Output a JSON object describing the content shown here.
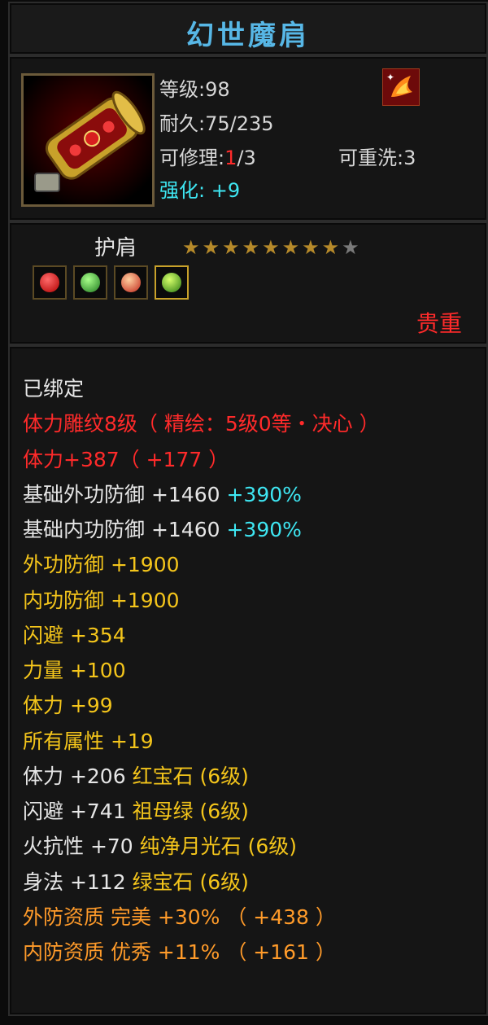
{
  "item": {
    "name": "幻世魔肩",
    "level_label": "等级:98",
    "durability_label": "耐久:75/235",
    "repair_prefix": "可修理:",
    "repair_current": "1",
    "repair_suffix": "/3",
    "rewash_label": "可重洗:3",
    "enhance_label": "强化:",
    "enhance_value": "+9",
    "type": "护肩",
    "stars_on": "★★★★★★★★",
    "stars_off": "★",
    "quality": "贵重",
    "icon": "shoulder-armor-icon",
    "badge_icon": "fire-bird-icon",
    "gem_icons": [
      "red-gem-icon",
      "green-leaf-gem-icon",
      "flame-gem-icon",
      "green-orb-gem-icon"
    ]
  },
  "lines": [
    {
      "parts": [
        {
          "text": "已绑定",
          "color": "white"
        }
      ]
    },
    {
      "parts": [
        {
          "text": "体力雕纹8级（ 精绘：5级0等・决心 ）",
          "color": "red"
        }
      ]
    },
    {
      "parts": [
        {
          "text": "体力+387（ +177 ）",
          "color": "red"
        }
      ]
    },
    {
      "parts": [
        {
          "text": "基础外功防御 +1460 ",
          "color": "white"
        },
        {
          "text": "+390%",
          "color": "cyan"
        }
      ]
    },
    {
      "parts": [
        {
          "text": "基础内功防御 +1460 ",
          "color": "white"
        },
        {
          "text": "+390%",
          "color": "cyan"
        }
      ]
    },
    {
      "parts": [
        {
          "text": "外功防御 +1900",
          "color": "yellow"
        }
      ]
    },
    {
      "parts": [
        {
          "text": "内功防御 +1900",
          "color": "yellow"
        }
      ]
    },
    {
      "parts": [
        {
          "text": "闪避 +354",
          "color": "yellow"
        }
      ]
    },
    {
      "parts": [
        {
          "text": "力量 +100",
          "color": "yellow"
        }
      ]
    },
    {
      "parts": [
        {
          "text": "体力 +99",
          "color": "yellow"
        }
      ]
    },
    {
      "parts": [
        {
          "text": "所有属性 +19",
          "color": "yellow"
        }
      ]
    },
    {
      "parts": [
        {
          "text": "体力 +206 ",
          "color": "white"
        },
        {
          "text": "红宝石 (6级)",
          "color": "yellow"
        }
      ]
    },
    {
      "parts": [
        {
          "text": "闪避 +741 ",
          "color": "white"
        },
        {
          "text": "祖母绿 (6级)",
          "color": "yellow"
        }
      ]
    },
    {
      "parts": [
        {
          "text": "火抗性 +70 ",
          "color": "white"
        },
        {
          "text": "纯净月光石 (6级)",
          "color": "yellow"
        }
      ]
    },
    {
      "parts": [
        {
          "text": "身法 +112 ",
          "color": "white"
        },
        {
          "text": "绿宝石 (6级)",
          "color": "yellow"
        }
      ]
    },
    {
      "parts": [
        {
          "text": "外防资质  完美 +30% （ +438 ）",
          "color": "orange"
        }
      ]
    },
    {
      "parts": [
        {
          "text": "内防资质  优秀 +11% （ +161 ）",
          "color": "orange"
        }
      ]
    }
  ],
  "colors": {
    "title": "#57b7e6",
    "red": "#ff2a2a",
    "yellow": "#f4c51b",
    "orange": "#ff9b2a",
    "cyan": "#3ee6f2",
    "white": "#e6e6e6"
  }
}
